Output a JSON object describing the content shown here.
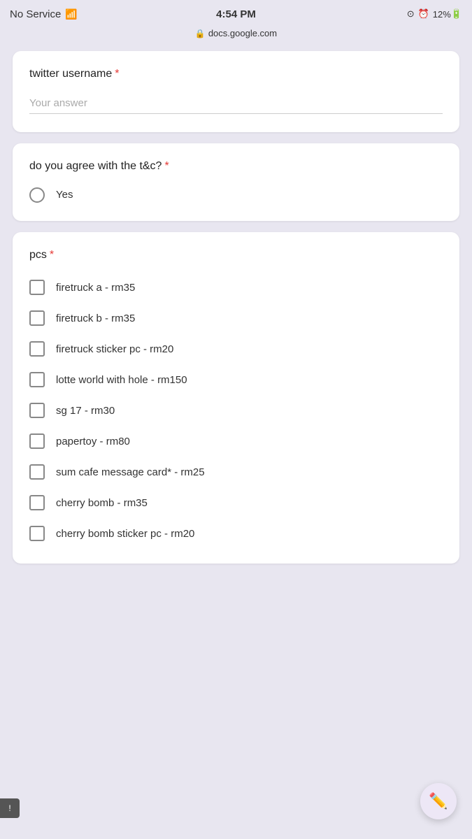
{
  "statusBar": {
    "carrier": "No Service",
    "time": "4:54 PM",
    "battery": "12%",
    "url": "docs.google.com"
  },
  "form": {
    "questions": [
      {
        "id": "twitter-username",
        "type": "text",
        "label": "twitter username",
        "required": true,
        "placeholder": "Your answer"
      },
      {
        "id": "agree-tnc",
        "type": "radio",
        "label": "do you agree with the t&c?",
        "required": true,
        "options": [
          {
            "id": "yes",
            "label": "Yes"
          }
        ]
      },
      {
        "id": "pcs",
        "type": "checkbox",
        "label": "pcs",
        "required": true,
        "options": [
          {
            "id": "firetruck-a",
            "label": "firetruck a - rm35"
          },
          {
            "id": "firetruck-b",
            "label": "firetruck b - rm35"
          },
          {
            "id": "firetruck-sticker-pc",
            "label": "firetruck sticker pc - rm20"
          },
          {
            "id": "lotte-world",
            "label": "lotte world with hole - rm150"
          },
          {
            "id": "sg17",
            "label": "sg 17 - rm30"
          },
          {
            "id": "papertoy",
            "label": "papertoy - rm80"
          },
          {
            "id": "sum-cafe",
            "label": "sum cafe message card* - rm25"
          },
          {
            "id": "cherry-bomb",
            "label": "cherry bomb - rm35"
          },
          {
            "id": "cherry-bomb-sticker",
            "label": "cherry bomb sticker pc - rm20"
          }
        ]
      }
    ]
  },
  "fab": {
    "icon": "✏️",
    "label": "Edit"
  },
  "feedback": {
    "icon": "!"
  }
}
